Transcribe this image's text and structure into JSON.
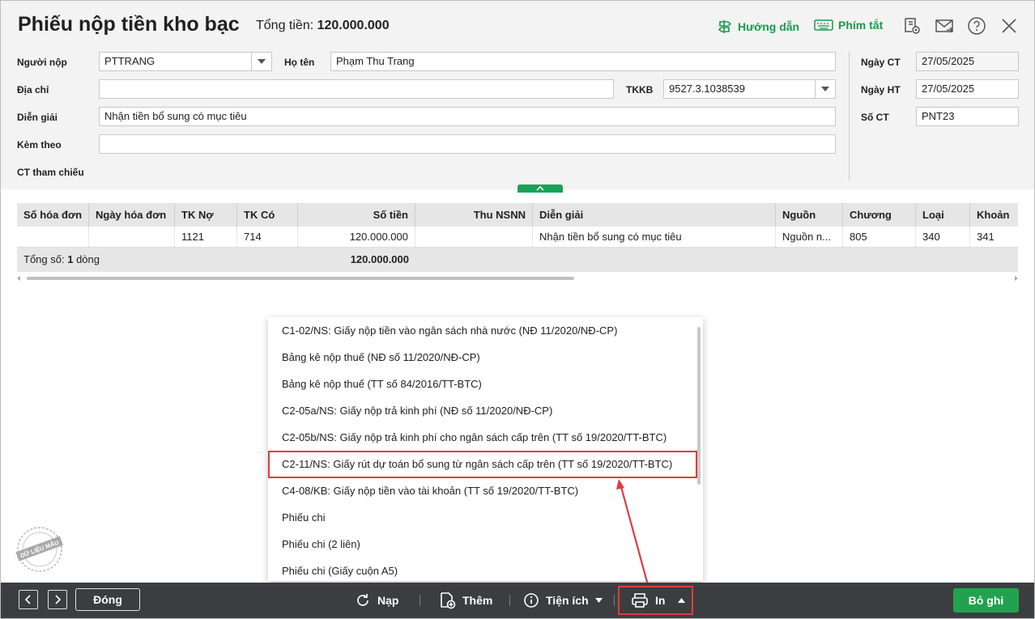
{
  "header": {
    "title": "Phiếu nộp tiền kho bạc",
    "total_label": "Tổng tiền:",
    "total_value": "120.000.000",
    "guide_label": "Hướng dẫn",
    "shortcuts_label": "Phím tắt"
  },
  "form": {
    "payer_label": "Người nộp",
    "payer_value": "PTTRANG",
    "fullname_label": "Họ tên",
    "fullname_value": "Phạm Thu Trang",
    "address_label": "Địa chỉ",
    "address_value": "",
    "tkkb_label": "TKKB",
    "tkkb_value": "9527.3.1038539",
    "description_label": "Diễn giải",
    "description_value": "Nhận tiền bổ sung có mục tiêu",
    "attached_label": "Kèm theo",
    "attached_value": "",
    "reference_label": "CT tham chiếu",
    "voucher_date_label": "Ngày CT",
    "voucher_date_value": "27/05/2025",
    "accounting_date_label": "Ngày HT",
    "accounting_date_value": "27/05/2025",
    "voucher_no_label": "Số CT",
    "voucher_no_value": "PNT23"
  },
  "grid": {
    "columns": [
      "Số hóa đơn",
      "Ngày hóa đơn",
      "TK Nợ",
      "TK Có",
      "Số tiền",
      "Thu NSNN",
      "Diễn giải",
      "Nguồn",
      "Chương",
      "Loại",
      "Khoản"
    ],
    "rows": [
      [
        "",
        "",
        "1121",
        "714",
        "120.000.000",
        "",
        "Nhận tiền bổ sung có mục tiêu",
        "Nguồn n...",
        "805",
        "340",
        "341"
      ]
    ],
    "footer_label": "Tổng số:",
    "footer_count": "1",
    "footer_unit": "dòng",
    "footer_total": "120.000.000"
  },
  "print_menu": {
    "items": [
      "C1-02/NS: Giấy nộp tiền vào ngân sách nhà nước (NĐ 11/2020/NĐ-CP)",
      "Bảng kê nộp thuế (NĐ số 11/2020/NĐ-CP)",
      "Bảng kê nộp thuế (TT số 84/2016/TT-BTC)",
      "C2-05a/NS: Giấy nộp trả kinh phí (NĐ số 11/2020/NĐ-CP)",
      "C2-05b/NS: Giấy nộp trả kinh phí cho ngân sách cấp trên (TT số 19/2020/TT-BTC)",
      "C2-11/NS: Giấy rút dự toán bổ sung từ ngân sách cấp trên (TT số 19/2020/TT-BTC)",
      "C4-08/KB: Giấy nộp tiền vào tài khoản (TT số 19/2020/TT-BTC)",
      "Phiếu chi",
      "Phiếu chi (2 liên)",
      "Phiếu chi (Giấy cuộn A5)"
    ],
    "highlighted_index": 5
  },
  "toolbar": {
    "close_label": "Đóng",
    "reload_label": "Nạp",
    "add_label": "Thêm",
    "utilities_label": "Tiện ích",
    "print_label": "In",
    "save_label": "Bỏ ghi"
  },
  "watermark": "DỮ LIỆU MẪU",
  "colors": {
    "accent_green": "#22a24e",
    "highlight_red": "#e03c3c",
    "toolbar_bg": "#3b3d40",
    "form_bg": "#f3f3f3"
  }
}
